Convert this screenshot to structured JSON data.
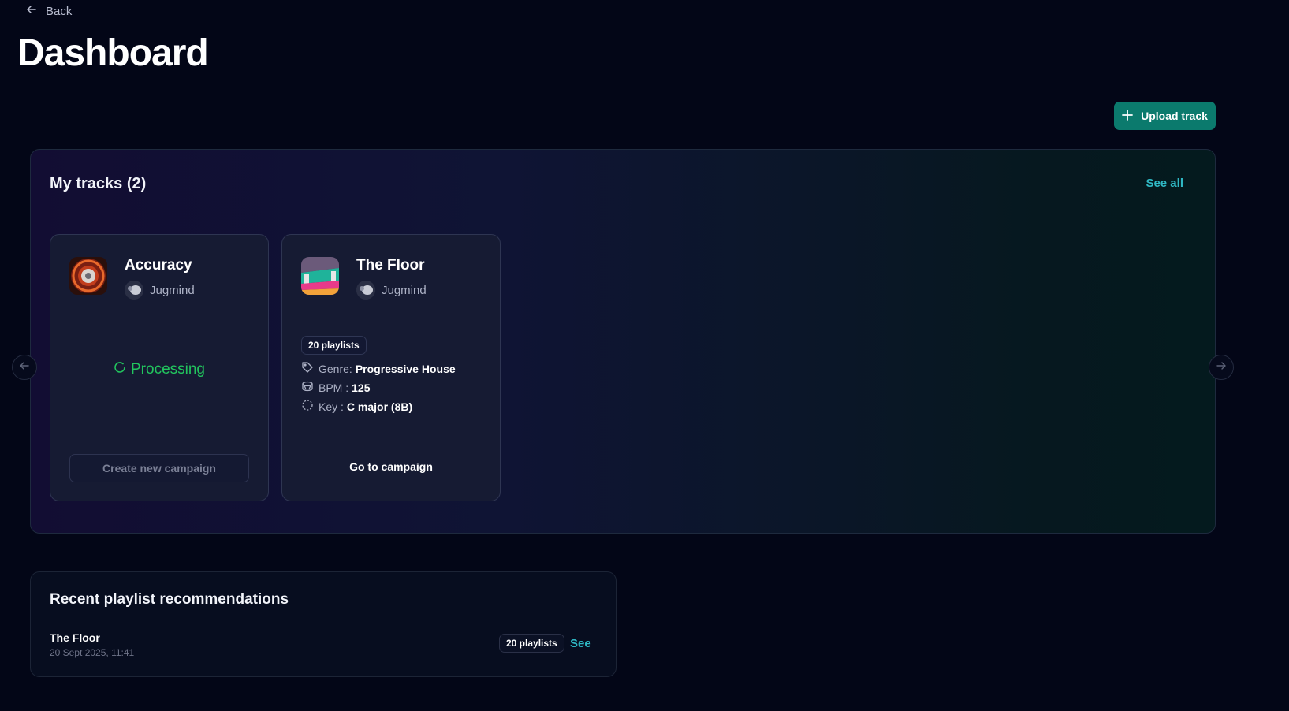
{
  "nav": {
    "back_label": "Back"
  },
  "page": {
    "title": "Dashboard"
  },
  "toolbar": {
    "upload_label": "Upload track",
    "upload_color": "#0b7a6d"
  },
  "tracks": {
    "title": "My tracks (2)",
    "see_all_label": "See all",
    "items": [
      {
        "name": "Accuracy",
        "artist": "Jugmind",
        "status": "Processing",
        "status_color": "#22c55e",
        "action_label": "Create new campaign"
      },
      {
        "name": "The Floor",
        "artist": "Jugmind",
        "playlists": "20 playlists",
        "genre_label": "Genre:",
        "genre": "Progressive House",
        "bpm_label": "BPM :",
        "bpm": "125",
        "key_label": "Key :",
        "key": "C major (8B)",
        "action_label": "Go to campaign"
      }
    ]
  },
  "recommendations": {
    "title": "Recent playlist recommendations",
    "items": [
      {
        "track": "The Floor",
        "date": "20 Sept 2025, 11:41",
        "playlists": "20 playlists",
        "see_label": "See"
      }
    ]
  },
  "colors": {
    "accent": "#2fb8c4",
    "background": "#030617"
  }
}
